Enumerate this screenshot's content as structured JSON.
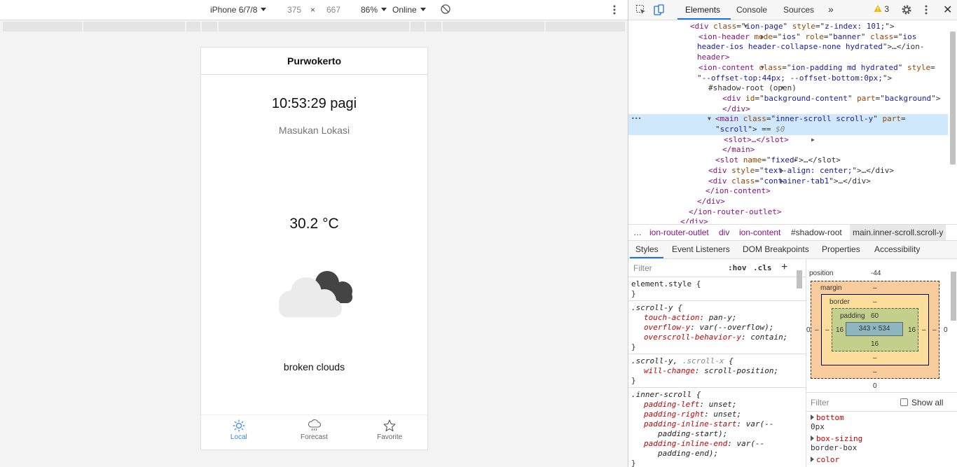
{
  "device_toolbar": {
    "device": "iPhone 6/7/8",
    "width": "375",
    "times": "×",
    "height": "667",
    "zoom": "86%",
    "network": "Online"
  },
  "app": {
    "header_title": "Purwokerto",
    "time": "10:53:29 pagi",
    "location_placeholder": "Masukan Lokasi",
    "temperature": "30.2 °C",
    "weather_icon": "broken-clouds-icon",
    "description": "broken clouds",
    "tabs": [
      {
        "label": "Local",
        "icon": "sun-icon",
        "active": true
      },
      {
        "label": "Forecast",
        "icon": "cloud-rain-icon",
        "active": false
      },
      {
        "label": "Favorite",
        "icon": "star-icon",
        "active": false
      }
    ],
    "accent_color": "#3880ff"
  },
  "devtools": {
    "tabs": [
      "Elements",
      "Console",
      "Sources"
    ],
    "more": "»",
    "warnings": "3",
    "dom_lines": [
      {
        "pre": "<div ",
        "parts": [
          [
            "an",
            "class"
          ],
          [
            "tx",
            "=\""
          ],
          [
            "av",
            "ion-page"
          ],
          [
            "tx",
            "\" "
          ],
          [
            "an",
            "style"
          ],
          [
            "tx",
            "=\""
          ],
          [
            "av",
            "z-index: 101;"
          ],
          [
            "tx",
            "\">"
          ]
        ]
      },
      {
        "pre": "<ion-header ",
        "parts": [
          [
            "an",
            "mode"
          ],
          [
            "tx",
            "=\""
          ],
          [
            "av",
            "ios"
          ],
          [
            "tx",
            "\" "
          ],
          [
            "an",
            "role"
          ],
          [
            "tx",
            "=\""
          ],
          [
            "av",
            "banner"
          ],
          [
            "tx",
            "\" "
          ],
          [
            "an",
            "class"
          ],
          [
            "tx",
            "=\""
          ],
          [
            "av",
            "ios"
          ]
        ]
      },
      {
        "pre": "",
        "parts": [
          [
            "av",
            "header-ios header-collapse-none hydrated"
          ],
          [
            "tx",
            "\">…</ion-"
          ]
        ]
      },
      {
        "pre": "header>",
        "parts": []
      },
      {
        "pre": "<ion-content ",
        "parts": [
          [
            "an",
            "class"
          ],
          [
            "tx",
            "=\""
          ],
          [
            "av",
            "ion-padding md hydrated"
          ],
          [
            "tx",
            "\" "
          ],
          [
            "an",
            "style"
          ],
          [
            "tx",
            "="
          ]
        ]
      },
      {
        "pre": "",
        "parts": [
          [
            "tx",
            "\""
          ],
          [
            "av",
            "--offset-top:44px; --offset-bottom:0px;"
          ],
          [
            "tx",
            "\">"
          ]
        ]
      },
      {
        "pre": "",
        "parts": [
          [
            "tx",
            "#shadow-root (open)"
          ]
        ]
      },
      {
        "pre": "<div ",
        "parts": [
          [
            "an",
            "id"
          ],
          [
            "tx",
            "=\""
          ],
          [
            "av",
            "background-content"
          ],
          [
            "tx",
            "\" "
          ],
          [
            "an",
            "part"
          ],
          [
            "tx",
            "=\""
          ],
          [
            "av",
            "background"
          ],
          [
            "tx",
            "\">"
          ]
        ]
      },
      {
        "pre": "</div>",
        "parts": []
      },
      {
        "pre": "<main ",
        "parts": [
          [
            "an",
            "class"
          ],
          [
            "tx",
            "=\""
          ],
          [
            "av",
            "inner-scroll scroll-y"
          ],
          [
            "tx",
            "\" "
          ],
          [
            "an",
            "part"
          ],
          [
            "tx",
            "="
          ]
        ]
      },
      {
        "pre": "",
        "parts": [
          [
            "tx",
            "\""
          ],
          [
            "av",
            "scroll"
          ],
          [
            "tx",
            "\"> == "
          ],
          [
            "tx",
            "$0"
          ]
        ]
      },
      {
        "pre": "<slot>…</slot>",
        "parts": []
      },
      {
        "pre": "</main>",
        "parts": []
      },
      {
        "pre": "<slot ",
        "parts": [
          [
            "an",
            "name"
          ],
          [
            "tx",
            "=\""
          ],
          [
            "av",
            "fixed"
          ],
          [
            "tx",
            "\">…</slot>"
          ]
        ]
      },
      {
        "pre": "<div ",
        "parts": [
          [
            "an",
            "style"
          ],
          [
            "tx",
            "=\""
          ],
          [
            "av",
            "text-align: center;"
          ],
          [
            "tx",
            "\">…</div>"
          ]
        ]
      },
      {
        "pre": "<div ",
        "parts": [
          [
            "an",
            "class"
          ],
          [
            "tx",
            "=\""
          ],
          [
            "av",
            "container-tab1"
          ],
          [
            "tx",
            "\">…</div>"
          ]
        ]
      },
      {
        "pre": "</ion-content>",
        "parts": []
      },
      {
        "pre": "</div>",
        "parts": []
      },
      {
        "pre": "</ion-router-outlet>",
        "parts": []
      },
      {
        "pre": "</div>",
        "parts": []
      }
    ],
    "breadcrumbs": [
      "…",
      "ion-router-outlet",
      "div",
      "ion-content",
      "#shadow-root",
      "main.inner-scroll.scroll-y"
    ],
    "subtabs": [
      "Styles",
      "Event Listeners",
      "DOM Breakpoints",
      "Properties",
      "Accessibility"
    ],
    "filter_placeholder": "Filter",
    "hov": ":hov",
    "cls": ".cls",
    "plus": "+",
    "rules": [
      {
        "selector": "element.style {",
        "props": [],
        "close": "}"
      },
      {
        "selector": ".scroll-y {",
        "props": [
          [
            "touch-action",
            "pan-y;"
          ],
          [
            "overflow-y",
            "var(--overflow);"
          ],
          [
            "overscroll-behavior-y",
            "contain;"
          ]
        ],
        "close": "}"
      },
      {
        "selector": ".scroll-y, .scroll-x {",
        "props": [
          [
            "will-change",
            "scroll-position;"
          ]
        ],
        "close": "}"
      },
      {
        "selector": ".inner-scroll {",
        "props": [
          [
            "padding-left",
            "unset;"
          ],
          [
            "padding-right",
            "unset;"
          ],
          [
            "padding-inline-start",
            "var(--"
          ],
          [
            "",
            "padding-start);"
          ],
          [
            "padding-inline-end",
            "var(--"
          ],
          [
            "",
            "padding-end);"
          ]
        ],
        "close": "}"
      }
    ],
    "box_model": {
      "position_label": "position",
      "position_value": "-44",
      "margin_label": "margin",
      "border_label": "border",
      "padding_label": "padding",
      "padding_top": "60",
      "padding_left": "16",
      "padding_right": "16",
      "padding_bottom": "16",
      "content": "343 × 534",
      "dash": "–",
      "bottom_value": "0",
      "side_value": "0"
    },
    "computed_filter": "Filter",
    "show_all": "Show all",
    "computed": [
      {
        "name": "bottom",
        "value": "0px"
      },
      {
        "name": "box-sizing",
        "value": "border-box"
      },
      {
        "name": "color",
        "value": ""
      }
    ]
  }
}
